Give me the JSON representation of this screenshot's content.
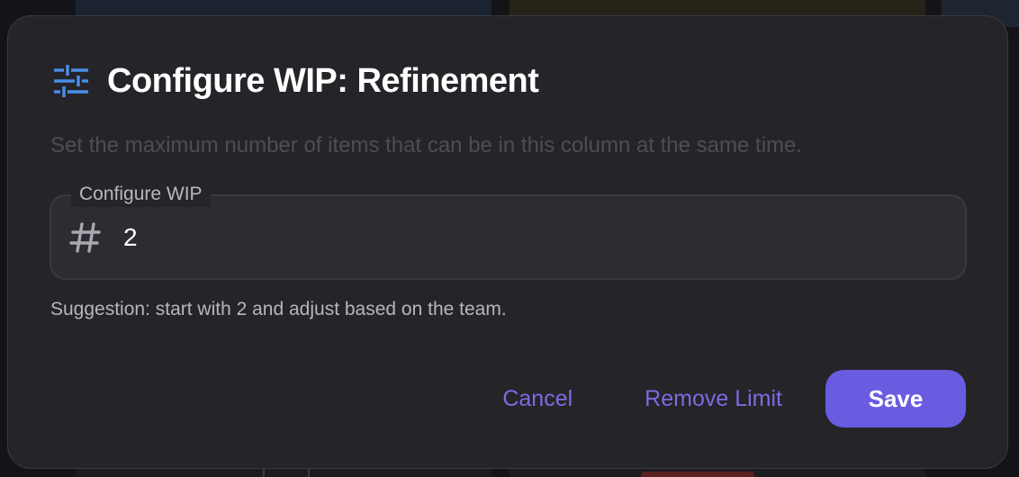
{
  "dialog": {
    "title": "Configure WIP: Refinement",
    "title_icon": "sliders-icon",
    "description": "Set the maximum number of items that can be in this column at the same time."
  },
  "field": {
    "label": "Configure WIP",
    "icon": "hash-icon",
    "value": "2"
  },
  "hint": "Suggestion: start with 2 and adjust based on the team.",
  "actions": {
    "cancel_label": "Cancel",
    "remove_label": "Remove Limit",
    "save_label": "Save"
  },
  "colors": {
    "accent": "#6a5ce0",
    "accent_text": "#7b6ce0",
    "icon_blue": "#4a8fe8",
    "dialog_bg": "#252429"
  }
}
